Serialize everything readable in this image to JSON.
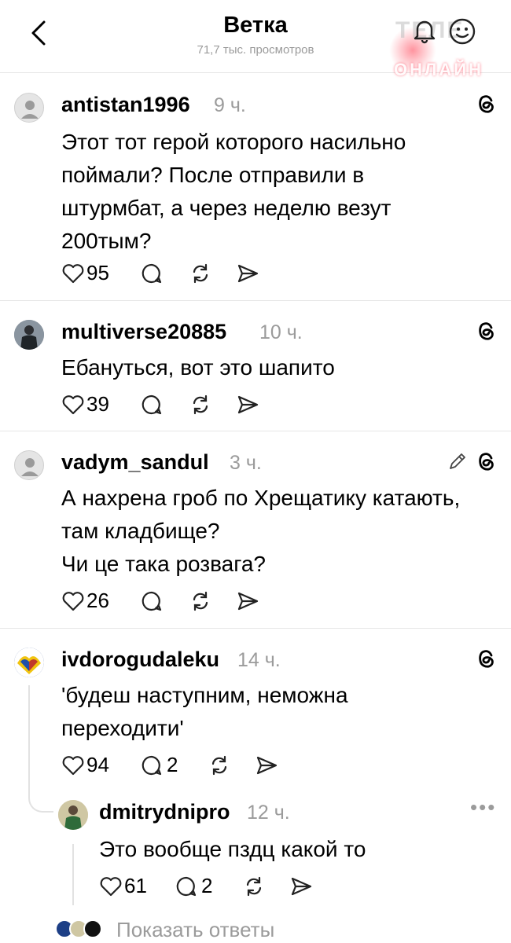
{
  "header": {
    "title": "Ветка",
    "subtitle": "71,7 тыс. просмотров",
    "watermark_top": "ТЕЛЕ",
    "watermark_bottom": "ОНЛАЙН"
  },
  "posts": [
    {
      "username": "antistan1996",
      "time": "9 ч.",
      "lines": [
        "Этот тот герой которого насильно",
        "поймали? После отправили в",
        "штурмбат, а через неделю везут",
        "200тым?"
      ],
      "likes": "95"
    },
    {
      "username": "multiverse20885",
      "time": "10 ч.",
      "lines": [
        "Ебануться, вот это шапито"
      ],
      "likes": "39"
    },
    {
      "username": "vadym_sandul",
      "time": "3 ч.",
      "lines": [
        "А нахрена гроб по Хрещатику катають,",
        "там кладбище?",
        "Чи це така розвага?"
      ],
      "likes": "26"
    },
    {
      "username": "ivdorogudaleku",
      "time": "14 ч.",
      "lines": [
        "'будеш наступним, неможна",
        "переходити'"
      ],
      "likes": "94",
      "replies": "2"
    }
  ],
  "reply": {
    "username": "dmitrydnipro",
    "time": "12 ч.",
    "lines": [
      "Это вообще пздц какой то"
    ],
    "likes": "61",
    "replies": "2"
  },
  "show_replies": "Показать ответы",
  "colors": {
    "muted": "#9b9b9b",
    "divider": "#e6e6e6"
  }
}
